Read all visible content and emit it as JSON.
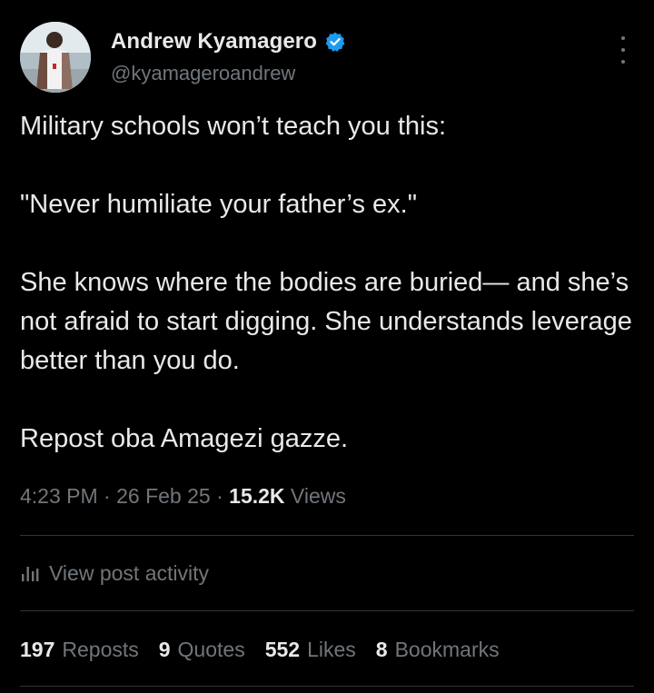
{
  "author": {
    "display_name": "Andrew Kyamagero",
    "handle": "@kyamageroandrew",
    "verified": true
  },
  "post": {
    "paragraphs": [
      "Military schools won’t teach you this:",
      "\"Never humiliate your father’s ex.\"",
      "She knows where the bodies are buried— and she’s not afraid to start digging. She understands leverage better than you do.",
      "Repost oba Amagezi gazze."
    ],
    "time": "4:23 PM",
    "separator": "·",
    "date": "26 Feb 25",
    "views_count": "15.2K",
    "views_label": "Views"
  },
  "activity": {
    "label": "View post activity",
    "icon": "bar-chart-icon"
  },
  "stats": [
    {
      "count": "197",
      "label": "Reposts"
    },
    {
      "count": "9",
      "label": "Quotes"
    },
    {
      "count": "552",
      "label": "Likes"
    },
    {
      "count": "8",
      "label": "Bookmarks"
    }
  ],
  "colors": {
    "background": "#000000",
    "text_primary": "#e7e9ea",
    "text_secondary": "#71767b",
    "divider": "#2f3336",
    "verified_badge": "#1d9bf0"
  }
}
